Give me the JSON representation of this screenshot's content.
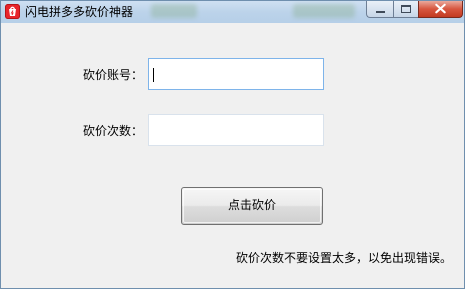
{
  "window": {
    "title": "闪电拼多多砍价神器",
    "icon": "lightning-app-icon",
    "caption_buttons": [
      "minimize-icon",
      "maximize-icon",
      "close-icon"
    ]
  },
  "form": {
    "account_label": "砍价账号：",
    "account_value": "",
    "count_label": "砍价次数：",
    "count_value": ""
  },
  "actions": {
    "submit_label": "点击砍价"
  },
  "note": "砍价次数不要设置太多，以免出现错误。",
  "colors": {
    "window_bg": "#f0f0f0",
    "title_bar": "#bcd3ea",
    "close_button": "#c9432b",
    "focus_border": "#7eb4ea"
  }
}
